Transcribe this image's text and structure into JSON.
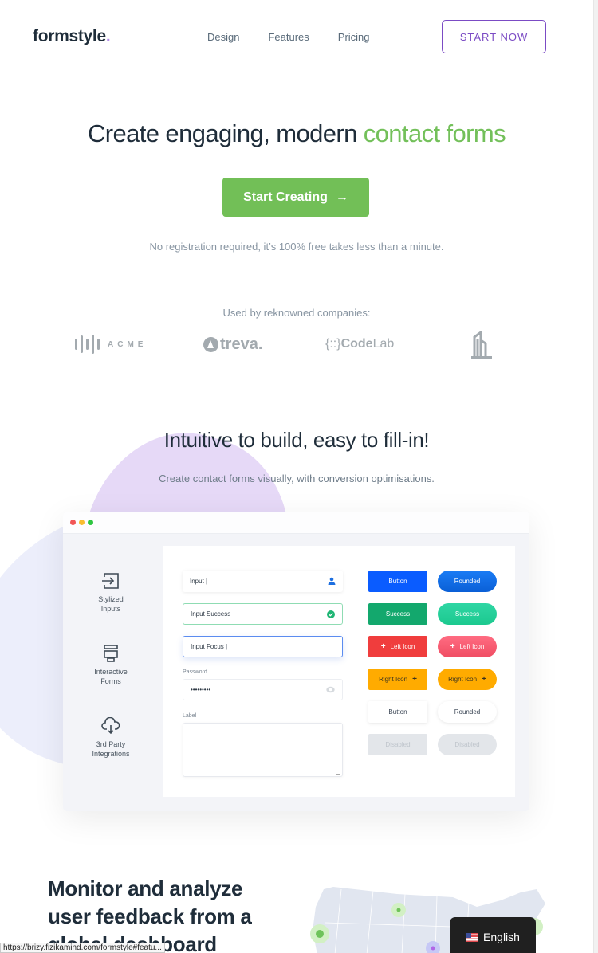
{
  "header": {
    "logo": "formstyle",
    "logo_dot": ".",
    "nav": [
      "Design",
      "Features",
      "Pricing"
    ],
    "cta": "START NOW"
  },
  "hero": {
    "title_main": "Create engaging, modern ",
    "title_accent": "contact forms",
    "button": "Start Creating",
    "button_icon": "→",
    "subtitle": "No registration required, it’s 100% free takes less than a minute."
  },
  "companies": {
    "label": "Used by reknowned companies:",
    "logos": [
      {
        "name": "ACME"
      },
      {
        "name": "treva."
      },
      {
        "prefix": "{::}",
        "bold": "Code",
        "light": "Lab"
      },
      {
        "name": "building-logo"
      }
    ]
  },
  "features": {
    "title": "Intuitive to build, easy to fill-in!",
    "subtitle": "Create contact forms visually, with conversion optimisations.",
    "sidebar": [
      {
        "line1": "Stylized",
        "line2": "Inputs",
        "icon": "login-arrow-icon"
      },
      {
        "line1": "Interactive",
        "line2": "Forms",
        "icon": "form-layout-icon"
      },
      {
        "line1": "3rd Party",
        "line2": "Integrations",
        "icon": "cloud-download-icon"
      }
    ],
    "inputs": {
      "default": "Input |",
      "success": "Input Success",
      "focus": "Input Focus |",
      "password_label": "Password",
      "password_value": "•••••••••",
      "textarea_label": "Label"
    },
    "buttons": {
      "square": [
        "Button",
        "Success",
        "Left Icon",
        "Right Icon",
        "Button",
        "Disabled"
      ],
      "rounded": [
        "Rounded",
        "Success",
        "Left Icon",
        "Right Icon",
        "Rounded",
        "Disabled"
      ]
    },
    "colors": {
      "blue": "#0a5cff",
      "green": "#13a86d",
      "red": "#f03d3d",
      "amber": "#ffab00",
      "accent_green": "#72bf57",
      "accent_purple": "#7b4bc4"
    }
  },
  "analytics": {
    "title": "Monitor and analyze user feedback from a global dashboard"
  },
  "browser": {
    "status_url": "https://brizy.fizikamind.com/formstyle#featu...",
    "language": "English"
  }
}
